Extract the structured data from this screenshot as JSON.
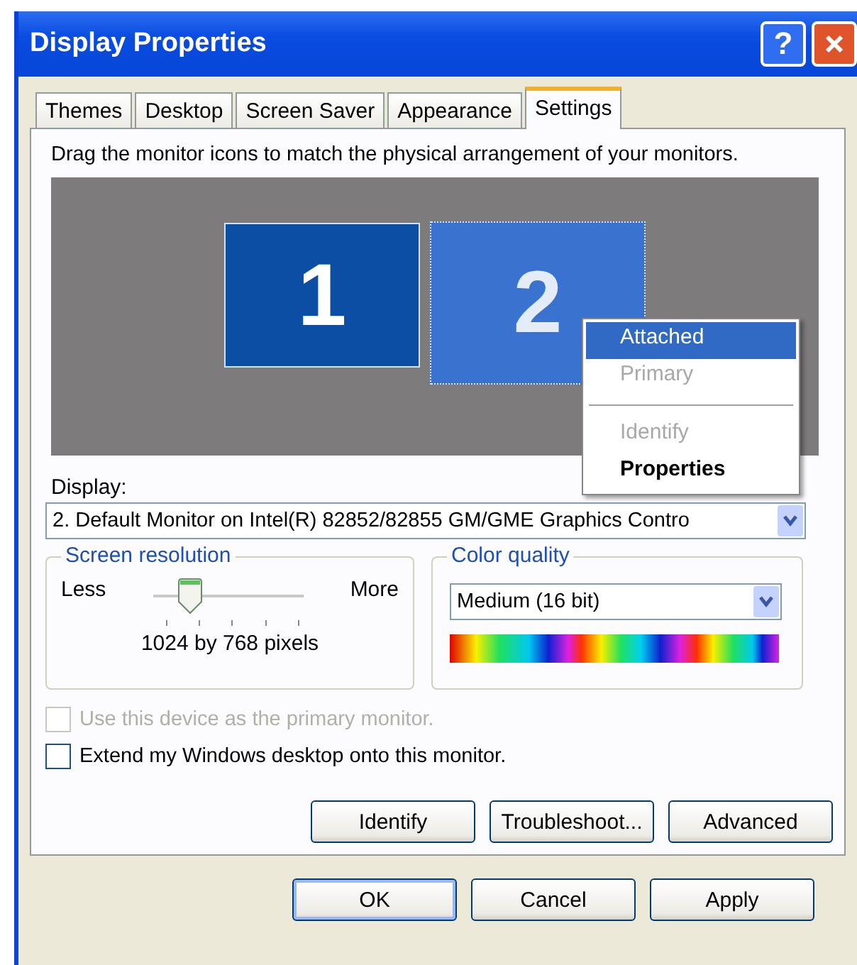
{
  "window": {
    "title": "Display Properties",
    "help_button": "?"
  },
  "tabs": [
    {
      "label": "Themes",
      "selected": false
    },
    {
      "label": "Desktop",
      "selected": false
    },
    {
      "label": "Screen Saver",
      "selected": false
    },
    {
      "label": "Appearance",
      "selected": false
    },
    {
      "label": "Settings",
      "selected": true
    }
  ],
  "instructions": "Drag the monitor icons to match the physical arrangement of your monitors.",
  "monitors": [
    {
      "number": "1",
      "selected": false
    },
    {
      "number": "2",
      "selected": true
    }
  ],
  "context_menu": [
    {
      "label": "Attached",
      "highlighted": true,
      "disabled": false,
      "default": false
    },
    {
      "label": "Primary",
      "highlighted": false,
      "disabled": true,
      "default": false
    },
    {
      "kind": "separator"
    },
    {
      "label": "Identify",
      "highlighted": false,
      "disabled": true,
      "default": false
    },
    {
      "label": "Properties",
      "highlighted": false,
      "disabled": false,
      "default": true
    }
  ],
  "display": {
    "label": "Display:",
    "value": "2. Default Monitor on Intel(R) 82852/82855 GM/GME Graphics Contro"
  },
  "screen_resolution": {
    "title": "Screen resolution",
    "less": "Less",
    "more": "More",
    "level": 0.25,
    "reading": "1024 by 768 pixels"
  },
  "color_quality": {
    "title": "Color quality",
    "value": "Medium (16 bit)"
  },
  "checkboxes": [
    {
      "label": "Use this device as the primary monitor.",
      "checked": false,
      "disabled": true
    },
    {
      "label": "Extend my Windows desktop onto this monitor.",
      "checked": false,
      "disabled": false
    }
  ],
  "panel_buttons": [
    "Identify",
    "Troubleshoot...",
    "Advanced"
  ],
  "dialog_buttons": [
    {
      "label": "OK",
      "default": true
    },
    {
      "label": "Cancel",
      "default": false
    },
    {
      "label": "Apply",
      "default": false
    }
  ]
}
